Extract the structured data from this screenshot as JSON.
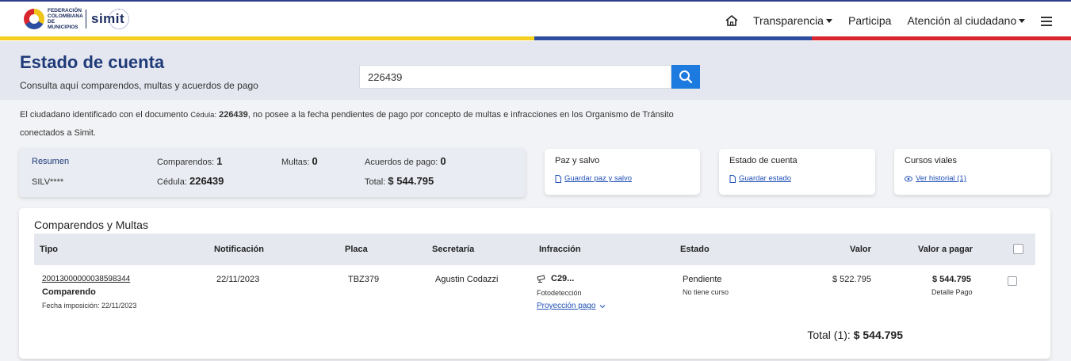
{
  "header": {
    "logo": {
      "org": "Federación Colombiana de Municipios",
      "brand": "simit"
    },
    "nav": {
      "transparencia": "Transparencia",
      "participa": "Participa",
      "atencion": "Atención al ciudadano"
    },
    "icons": {
      "home": "home-icon",
      "menu": "hamburger-menu-icon"
    },
    "stripe_colors": [
      "#f5d021",
      "#2d4e9e",
      "#d8262f"
    ]
  },
  "hero": {
    "title": "Estado de cuenta",
    "subtitle": "Consulta aquí comparendos, multas y acuerdos de pago",
    "search_value": "226439"
  },
  "notice": {
    "before": "El ciudadano identificado con el documento ",
    "doc_type": "Cédula:",
    "doc_number": "226439",
    "after": ", no posee a la fecha pendientes de pago por concepto de multas e infracciones en los Organismo de Tránsito conectados a Simit."
  },
  "summary": {
    "resumen": "Resumen",
    "name": "SILV****",
    "comparendos_label": "Comparendos:",
    "comparendos_value": "1",
    "cedula_label": "Cédula:",
    "cedula_value": "226439",
    "multas_label": "Multas:",
    "multas_value": "0",
    "acuerdos_label": "Acuerdos de pago:",
    "acuerdos_value": "0",
    "total_label": "Total:",
    "total_value": "$ 544.795"
  },
  "cards": {
    "paz": {
      "title": "Paz y salvo",
      "link": "Guardar paz y salvo"
    },
    "estado": {
      "title": "Estado de cuenta",
      "link": "Guardar estado"
    },
    "cursos": {
      "title": "Cursos viales",
      "link": "Ver historial (1)"
    }
  },
  "table": {
    "title": "Comparendos y Multas",
    "headers": {
      "tipo": "Tipo",
      "notificacion": "Notificación",
      "placa": "Placa",
      "secretaria": "Secretaría",
      "infraccion": "Infracción",
      "estado": "Estado",
      "valor": "Valor",
      "valor_pagar": "Valor a pagar"
    },
    "row": {
      "numero": "20013000000038598344",
      "tipo": "Comparendo",
      "fecha_imposicion": "Fecha imposición: 22/11/2023",
      "notificacion": "22/11/2023",
      "placa": "TBZ379",
      "secretaria": "Agustin Codazzi",
      "infraccion_code": "C29...",
      "infraccion_tipo": "Fotodetección",
      "proyeccion": "Proyección pago",
      "estado": "Pendiente",
      "estado_sub": "No tiene curso",
      "valor": "$ 522.795",
      "valor_pagar": "$ 544.795",
      "detalle": "Detalle Pago"
    },
    "total_label": "Total (1):",
    "total_value": "$ 544.795"
  }
}
